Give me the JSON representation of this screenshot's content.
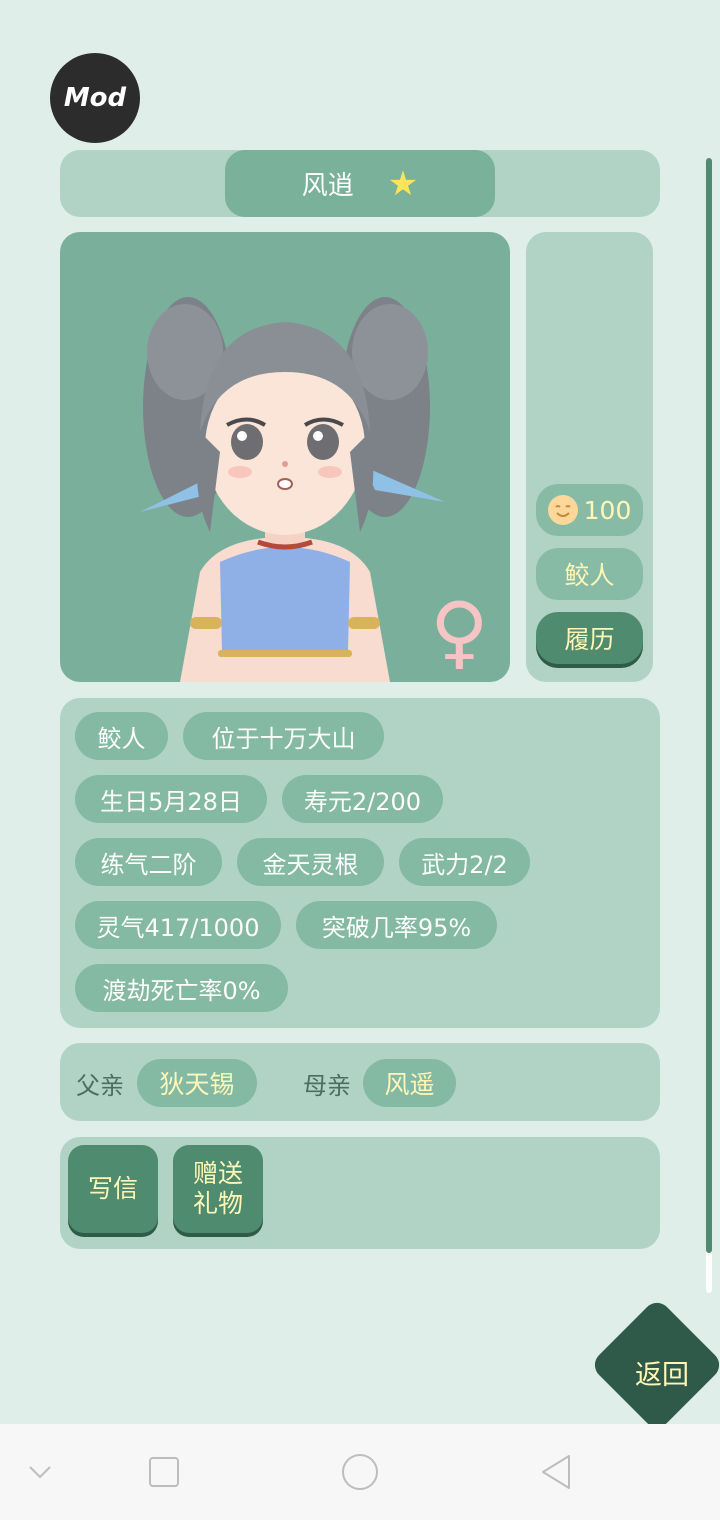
{
  "badge": {
    "label": "Mod"
  },
  "header": {
    "name": "风逍",
    "star_icon": "star-icon"
  },
  "character": {
    "gender_symbol": "♀"
  },
  "side_panel": {
    "mood_value": "100",
    "race": "鲛人",
    "history_label": "履历"
  },
  "info_tags": [
    "鲛人",
    "位于十万大山",
    "生日5月28日",
    "寿元2/200",
    "练气二阶",
    "金天灵根",
    "武力2/2",
    "灵气417/1000",
    "突破几率95%",
    "渡劫死亡率0%"
  ],
  "parents": {
    "father_label": "父亲",
    "father_name": "狄天锡",
    "mother_label": "母亲",
    "mother_name": "风遥"
  },
  "actions": {
    "write_letter": "写信",
    "gift_line1": "赠送",
    "gift_line2": "礼物"
  },
  "back_label": "返回",
  "colors": {
    "background": "#dfeee9",
    "panel": "#b0d3c6",
    "tag": "#84b9a3",
    "dark_button": "#4f8c6f",
    "accent_text": "#fff6b8",
    "back_button": "#2f5948"
  }
}
